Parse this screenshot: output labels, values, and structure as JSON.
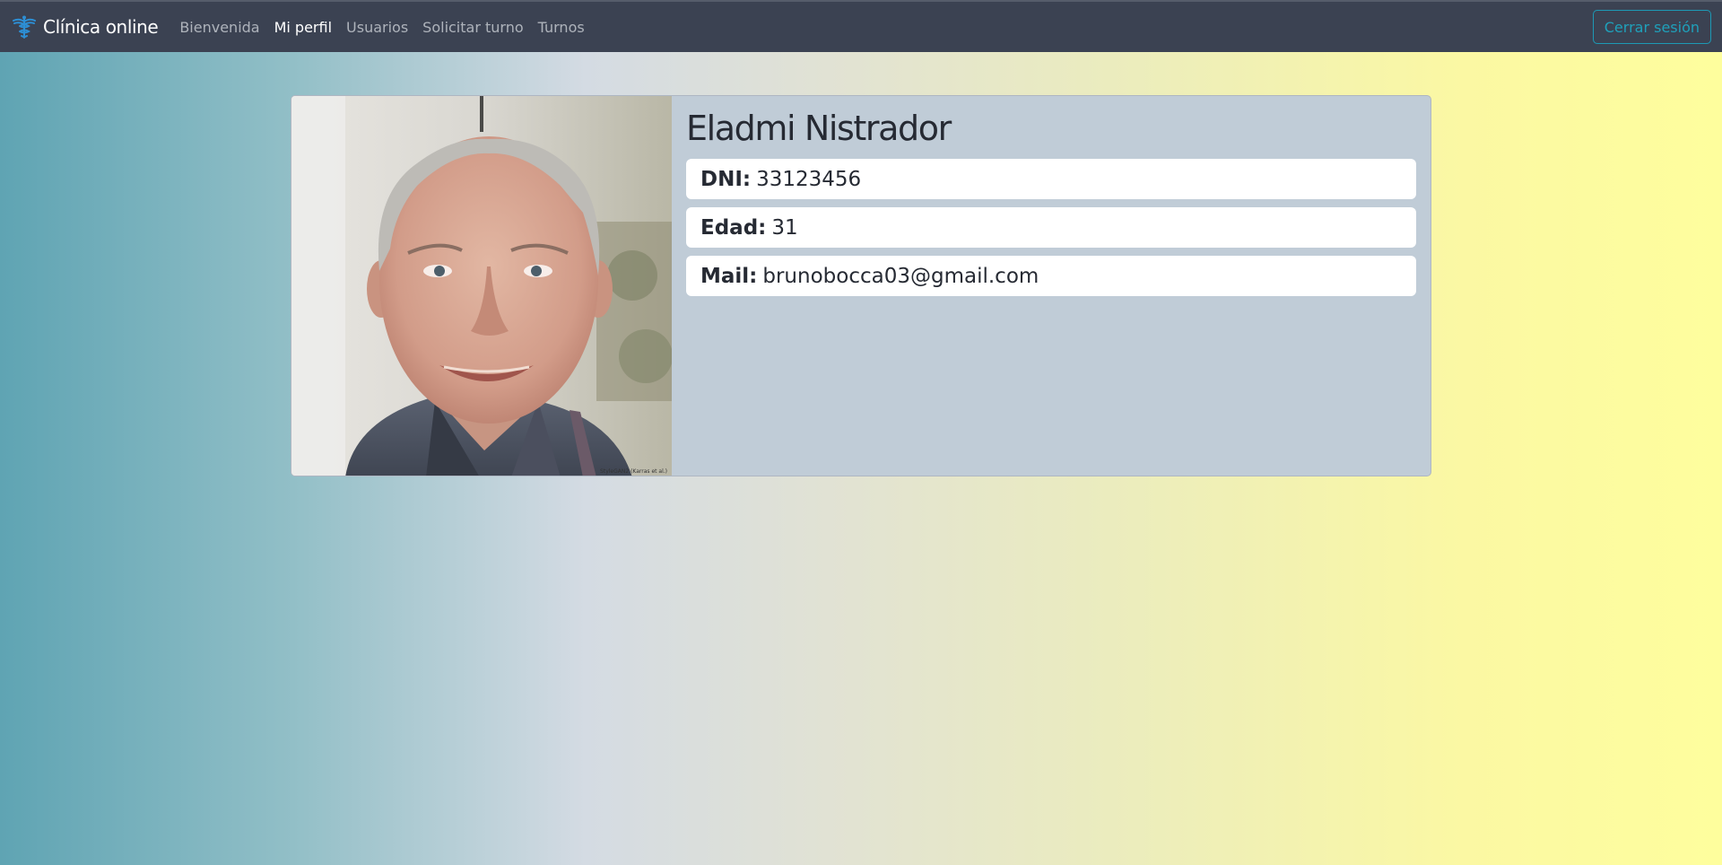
{
  "colors": {
    "topbar": "#3b4252",
    "accent": "#1fa0ba",
    "card": "#c0ccd7",
    "brand_icon": "#2d8fd5"
  },
  "navbar": {
    "brand": {
      "icon": "caduceus-icon",
      "text": "Clínica online"
    },
    "items": [
      {
        "label": "Bienvenida",
        "active": false
      },
      {
        "label": "Mi perfil",
        "active": true
      },
      {
        "label": "Usuarios",
        "active": false
      },
      {
        "label": "Solicitar turno",
        "active": false
      },
      {
        "label": "Turnos",
        "active": false
      }
    ],
    "logout_label": "Cerrar sesión"
  },
  "profile": {
    "photo_caption": "StyleGAN2 (Karras et al.)",
    "name": "Eladmi Nistrador",
    "fields": [
      {
        "label": "DNI:",
        "value": "33123456"
      },
      {
        "label": "Edad:",
        "value": "31"
      },
      {
        "label": "Mail:",
        "value": "brunobocca03@gmail.com"
      }
    ]
  }
}
